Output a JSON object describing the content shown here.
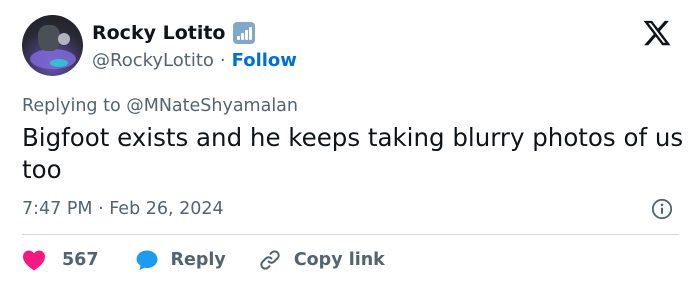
{
  "author": {
    "name": "Rocky Lotito",
    "handle": "@RockyLotito",
    "separator": "·",
    "follow_label": "Follow"
  },
  "tweet": {
    "reply_to": "Replying to @MNateShyamalan",
    "text": "Bigfoot exists and he keeps taking blurry photos of us too",
    "timestamp": "7:47 PM · Feb 26, 2024"
  },
  "actions": {
    "like_count": "567",
    "reply_label": "Reply",
    "copy_label": "Copy link"
  },
  "icons": {
    "verified": "signal-badge-icon",
    "logo": "x-logo-icon",
    "info": "info-icon",
    "like": "heart-icon",
    "reply": "speech-bubble-icon",
    "copy": "link-icon"
  },
  "colors": {
    "heart": "#f91880",
    "reply": "#1d9bf0",
    "follow": "#006fd6",
    "secondary_text": "#536471"
  }
}
